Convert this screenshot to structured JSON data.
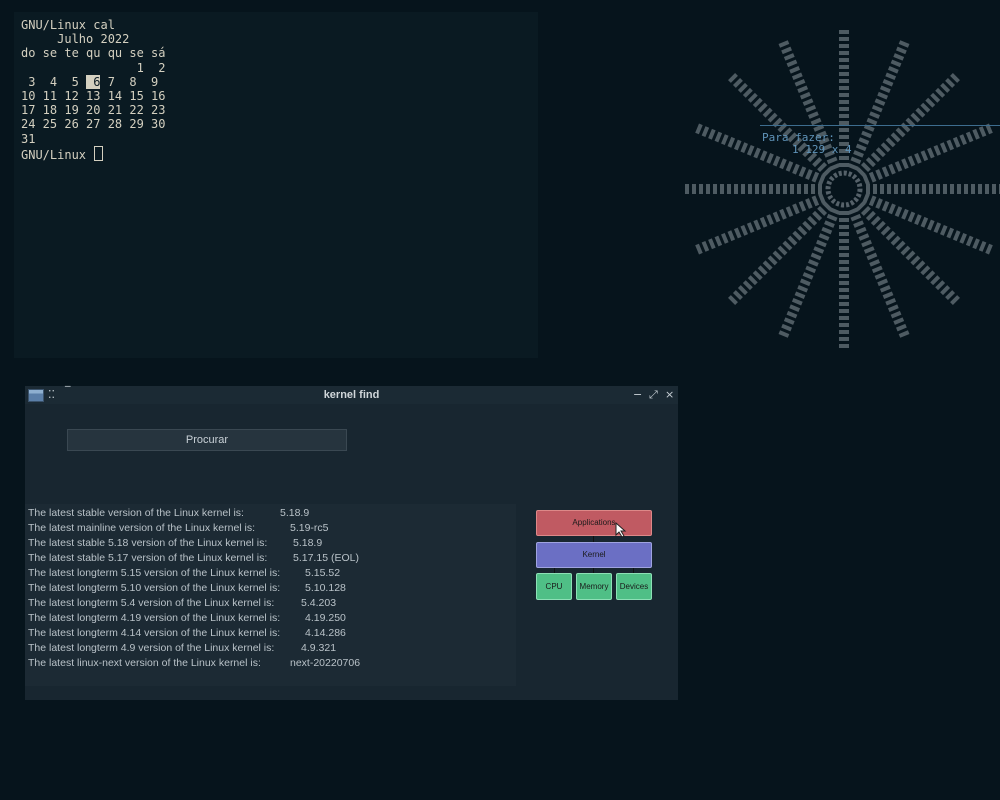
{
  "terminal": {
    "command_line": "GNU/Linux cal",
    "month_year": "     Julho 2022",
    "weekdays": "do se te qu qu se sá",
    "weeks": [
      "                1  2",
      " 3  4  5 ",
      "10 11 12 13 14 15 16",
      "17 18 19 20 21 22 23",
      "24 25 26 27 28 29 30",
      "31"
    ],
    "highlight_day": " 6",
    "week2_rest": " 7  8  9",
    "prompt": "GNU/Linux "
  },
  "todo": {
    "title": "Para fazer:",
    "item": "1 129 x 4"
  },
  "window": {
    "title": "kernel find",
    "controls": {
      "minimize": "−",
      "maximize": "⤢",
      "close": "×"
    },
    "search_button": "Procurar",
    "results": [
      {
        "label": "The latest stable version of the Linux kernel is:",
        "value": "5.18.9"
      },
      {
        "label": "The latest mainline version of the Linux kernel is:",
        "value": "5.19-rc5"
      },
      {
        "label": "The latest stable 5.18 version of the Linux kernel is:",
        "value": "5.18.9"
      },
      {
        "label": "The latest stable 5.17 version of the Linux kernel is:",
        "value": "5.17.15 (EOL)"
      },
      {
        "label": "The latest longterm 5.15 version of the Linux kernel is:",
        "value": "5.15.52"
      },
      {
        "label": "The latest longterm 5.10 version of the Linux kernel is:",
        "value": "5.10.128"
      },
      {
        "label": "The latest longterm 5.4 version of the Linux kernel is:",
        "value": "5.4.203"
      },
      {
        "label": "The latest longterm 4.19 version of the Linux kernel is:",
        "value": "4.19.250"
      },
      {
        "label": "The latest longterm 4.14 version of the Linux kernel is:",
        "value": "4.14.286"
      },
      {
        "label": "The latest longterm 4.9 version of the Linux kernel is:",
        "value": "4.9.321"
      },
      {
        "label": "The latest linux-next version of the Linux kernel is:",
        "value": "next-20220706"
      }
    ],
    "diagram": {
      "applications": "Applications",
      "kernel": "Kernel",
      "cpu": "CPU",
      "memory": "Memory",
      "devices": "Devices"
    }
  },
  "colors": {
    "background": "#06141c",
    "terminal_bg": "#0a1a22",
    "applications": "#c05a62",
    "kernel": "#6b6fc4",
    "hardware": "#4fbf86"
  }
}
